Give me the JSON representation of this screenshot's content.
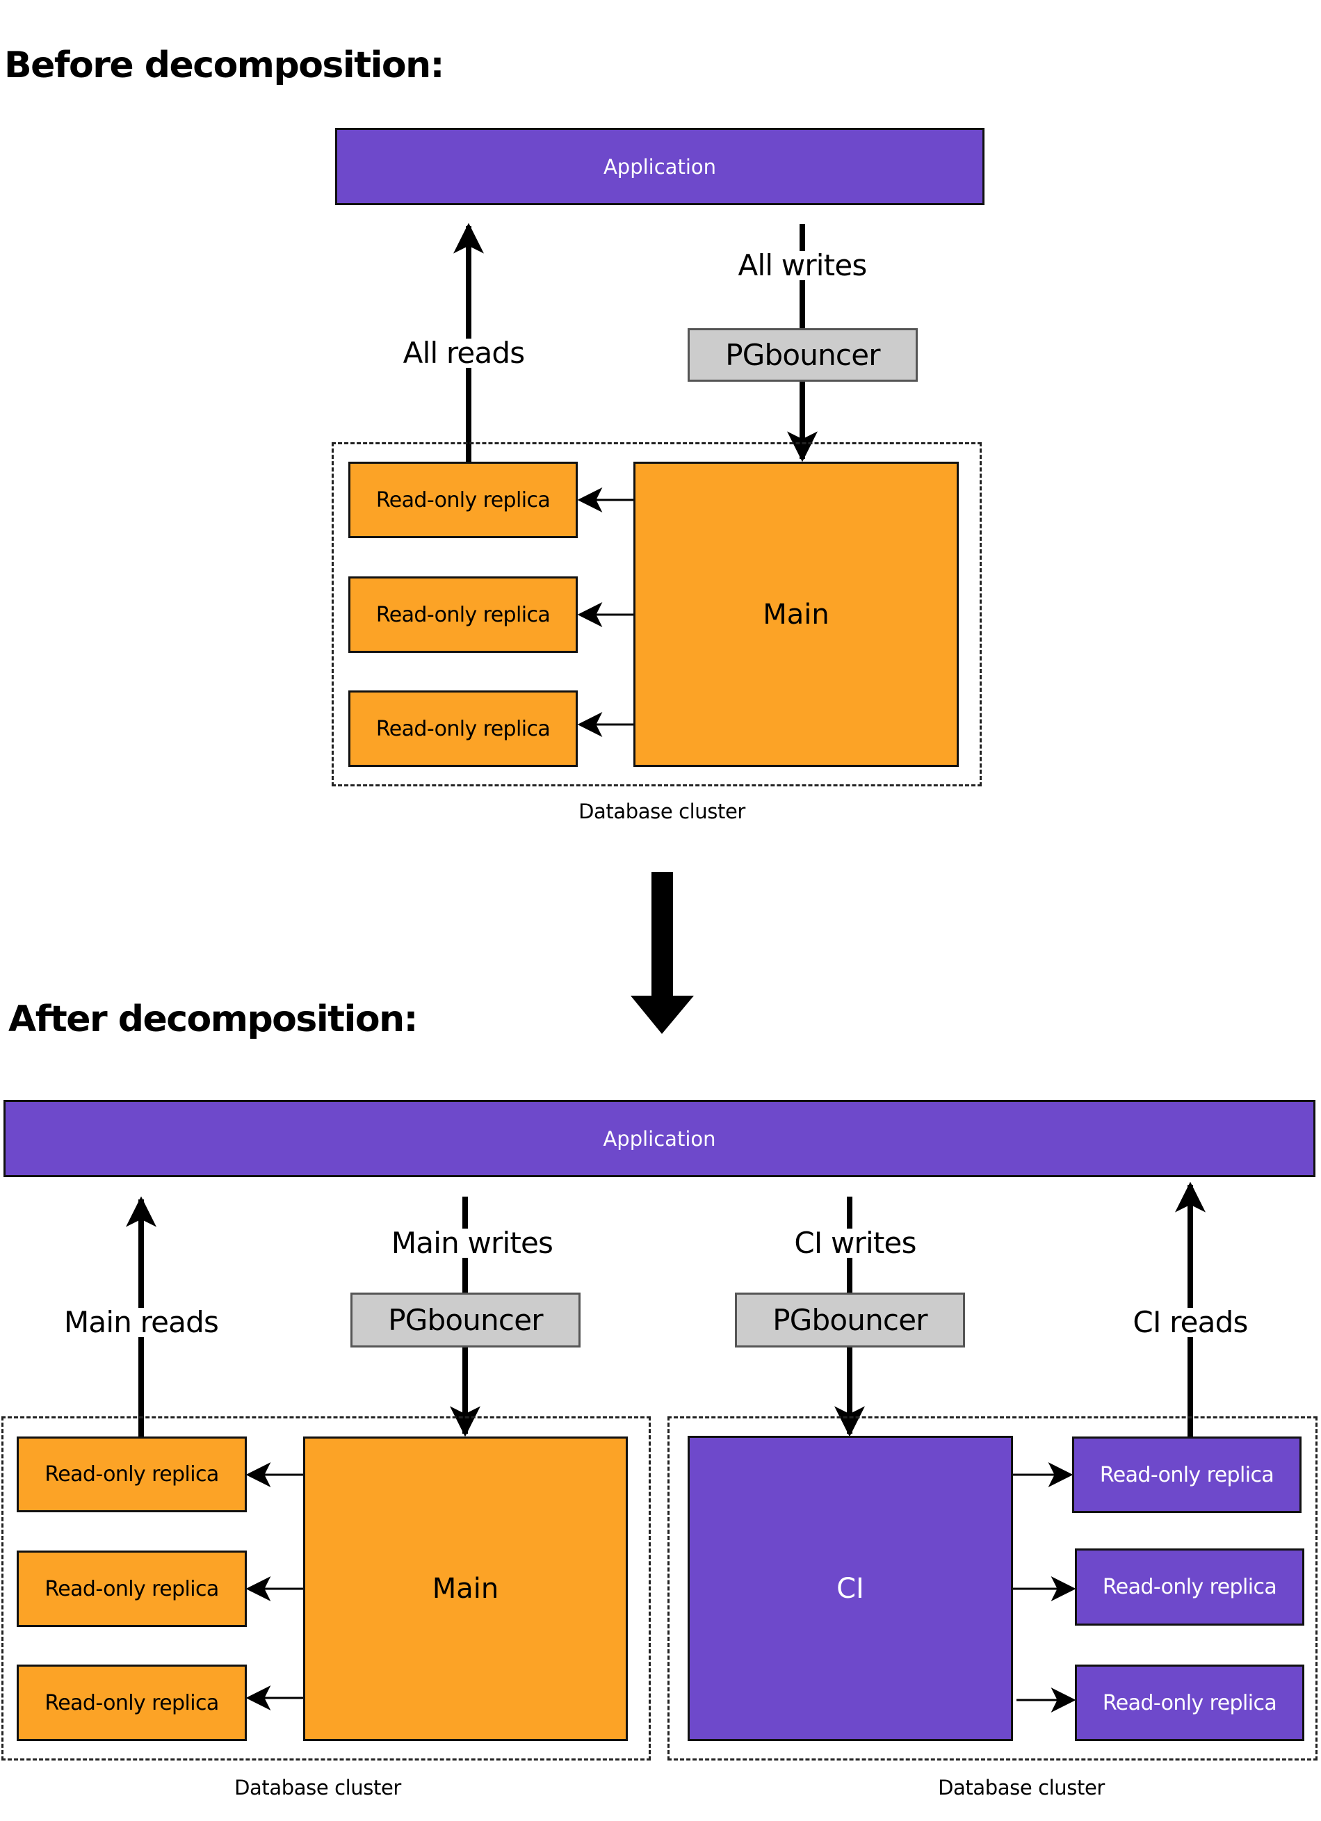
{
  "colors": {
    "application": "#6E49CB",
    "main_db": "#FCA326",
    "ci_db": "#6E49CB",
    "pgbouncer": "#CCCCCC",
    "arrow": "#000000"
  },
  "before": {
    "title": "Before decomposition:",
    "application": {
      "label": "Application"
    },
    "reads_label": "All reads",
    "writes_label": "All writes",
    "pgbouncer": {
      "label": "PGbouncer"
    },
    "cluster": {
      "label": "Database cluster",
      "primary": {
        "label": "Main"
      },
      "replicas": [
        {
          "label": "Read-only replica"
        },
        {
          "label": "Read-only replica"
        },
        {
          "label": "Read-only replica"
        }
      ]
    }
  },
  "transition": {
    "icon": "arrow-down-icon"
  },
  "after": {
    "title": "After decomposition:",
    "application": {
      "label": "Application"
    },
    "main": {
      "reads_label": "Main reads",
      "writes_label": "Main writes",
      "pgbouncer": {
        "label": "PGbouncer"
      },
      "cluster": {
        "label": "Database cluster",
        "primary": {
          "label": "Main"
        },
        "replicas": [
          {
            "label": "Read-only replica"
          },
          {
            "label": "Read-only replica"
          },
          {
            "label": "Read-only replica"
          }
        ]
      }
    },
    "ci": {
      "reads_label": "CI reads",
      "writes_label": "CI writes",
      "pgbouncer": {
        "label": "PGbouncer"
      },
      "cluster": {
        "label": "Database cluster",
        "primary": {
          "label": "CI"
        },
        "replicas": [
          {
            "label": "Read-only replica"
          },
          {
            "label": "Read-only replica"
          },
          {
            "label": "Read-only replica"
          }
        ]
      }
    }
  }
}
